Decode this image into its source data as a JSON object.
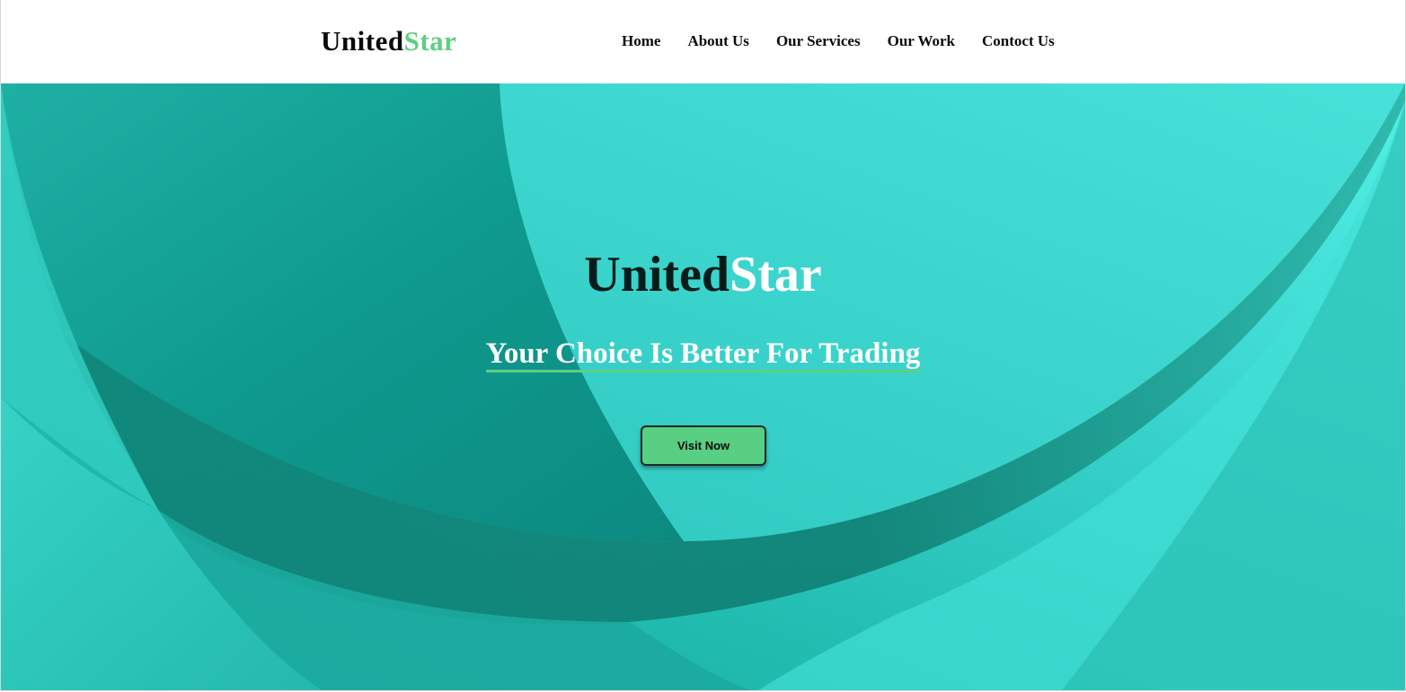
{
  "header": {
    "brand": {
      "part1": "United",
      "part2": "Star"
    },
    "nav": [
      {
        "label": "Home"
      },
      {
        "label": "About Us"
      },
      {
        "label": "Our Services"
      },
      {
        "label": "Our Work"
      },
      {
        "label": "Contoct Us"
      }
    ]
  },
  "hero": {
    "title": {
      "part1": "United",
      "part2": "Star"
    },
    "tagline": "Your Choice Is Better For Trading",
    "button_label": "Visit Now"
  },
  "colors": {
    "accent_green": "#5ecf83",
    "button_green": "#58cf82",
    "hero_teal_dark": "#0b7f75",
    "hero_teal_light": "#53f0e6",
    "text_dark": "#0b0b0b"
  }
}
